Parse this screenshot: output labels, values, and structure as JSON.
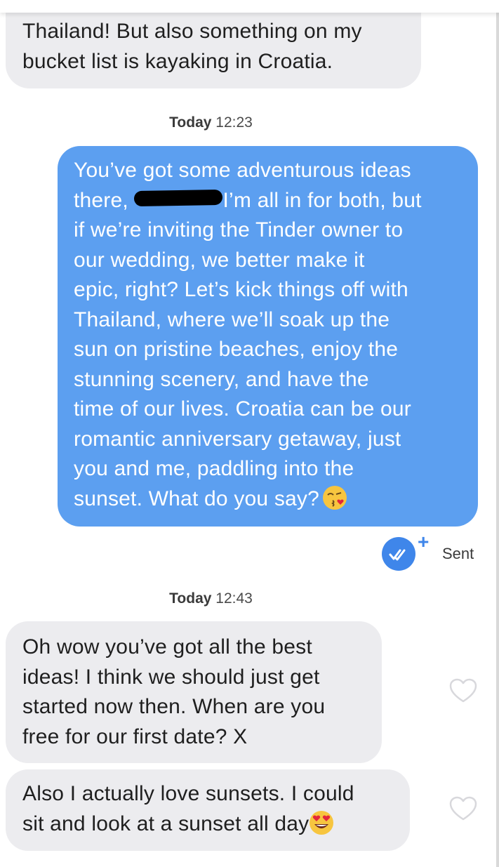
{
  "messages": [
    {
      "direction": "received",
      "text": "Thailand! But also something on my\nbucket list is kayaking in Croatia."
    },
    {
      "direction": "sent",
      "text_a": "You’ve got some adventurous ideas\nthere, ",
      "text_b": "I’m all in for both, but\nif we’re inviting the Tinder owner to\nour wedding, we better make it\nepic, right? Let’s kick things off with\nThailand, where we’ll soak up the\nsun on pristine beaches, enjoy the\nstunning scenery, and have the\ntime of our lives. Croatia can be our\nromantic anniversary getaway, just\nyou and me, paddling into the\nsunset. What do you say?",
      "emoji": "kissing-face-emoji"
    },
    {
      "direction": "received",
      "text": "Oh wow you’ve got all the best\nideas! I think we should just get\nstarted now then. When are you\nfree for our first date? X"
    },
    {
      "direction": "received",
      "text": "Also I actually love sunsets. I could\nsit and look at a sunset all day",
      "emoji": "heart-eyes-emoji"
    }
  ],
  "timestamps": [
    {
      "day": "Today",
      "time": "12:23"
    },
    {
      "day": "Today",
      "time": "12:43"
    }
  ],
  "status": {
    "label": "Sent",
    "plus": "+"
  },
  "colors": {
    "sent_bubble": "#5c9ff0",
    "received_bubble": "#ececef",
    "accent": "#3f86ea"
  }
}
